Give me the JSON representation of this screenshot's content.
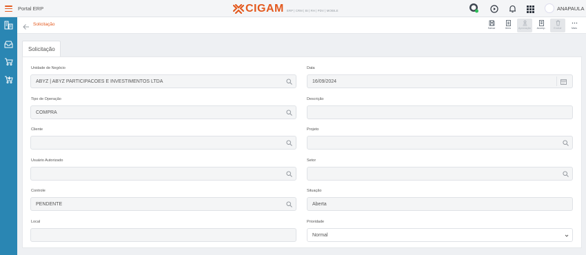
{
  "header": {
    "portal_title": "Portal ERP",
    "logo_text": "CIGAM",
    "logo_subtitle": "ERP | CRM | BI | RH | PDV | MOBILE",
    "user_name": "ANAPAULA",
    "brand_color": "#e35a1f",
    "sidebar_color": "#2a86b3"
  },
  "breadcrumb": {
    "title": "Solicitação"
  },
  "toolbar": {
    "buttons": [
      {
        "label": "Salvar",
        "icon": "save-icon",
        "disabled": false
      },
      {
        "label": "Itens",
        "icon": "list-icon",
        "disabled": false
      },
      {
        "label": "Aprovação",
        "icon": "approval-icon",
        "disabled": true
      },
      {
        "label": "Acomp.",
        "icon": "document-icon",
        "disabled": false
      },
      {
        "label": "Excluir",
        "icon": "trash-icon",
        "disabled": true
      },
      {
        "label": "Mais",
        "icon": "more-icon",
        "disabled": false
      }
    ]
  },
  "tab": {
    "label": "Solicitação"
  },
  "form": {
    "unidade": {
      "label": "Unidade de Negócio",
      "value": "ABYZ | ABYZ PARTICIPACOES E INVESTIMENTOS LTDA"
    },
    "data": {
      "label": "Data",
      "value": "16/09/2024"
    },
    "tipo_operacao": {
      "label": "Tipo de Operação",
      "value": "COMPRA"
    },
    "descricao": {
      "label": "Descrição",
      "value": ""
    },
    "cliente": {
      "label": "Cliente",
      "value": ""
    },
    "projeto": {
      "label": "Projeto",
      "value": ""
    },
    "usuario_autorizado": {
      "label": "Usuário Autorizado",
      "value": ""
    },
    "setor": {
      "label": "Setor",
      "value": ""
    },
    "controle": {
      "label": "Controle",
      "value": "PENDENTE"
    },
    "situacao": {
      "label": "Situação",
      "value": "Aberta"
    },
    "local": {
      "label": "Local",
      "value": ""
    },
    "prioridade": {
      "label": "Prioridade",
      "value": "Normal"
    }
  }
}
